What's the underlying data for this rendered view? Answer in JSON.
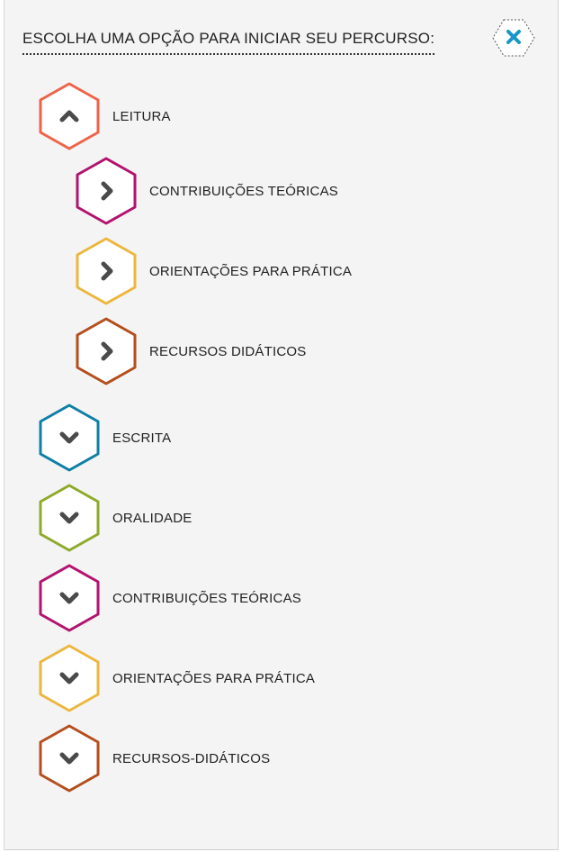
{
  "header": {
    "title": "ESCOLHA UMA OPÇÃO PARA INICIAR SEU PERCURSO:",
    "close_icon": "close-icon",
    "close_color": "#1a95c9"
  },
  "menu": [
    {
      "label": "LEITURA",
      "color": "#ee6349",
      "icon": "chevron-up-icon",
      "level": 0,
      "expanded": true
    },
    {
      "label": "CONTRIBUIÇÕES TEÓRICAS",
      "color": "#b3136f",
      "icon": "chevron-right-icon",
      "level": 1
    },
    {
      "label": "ORIENTAÇÕES PARA PRÁTICA",
      "color": "#ecb73f",
      "icon": "chevron-right-icon",
      "level": 1
    },
    {
      "label": "RECURSOS DIDÁTICOS",
      "color": "#b44e1d",
      "icon": "chevron-right-icon",
      "level": 1
    },
    {
      "label": "ESCRITA",
      "color": "#0f7fa6",
      "icon": "chevron-down-icon",
      "level": 0
    },
    {
      "label": "ORALIDADE",
      "color": "#8eaa2a",
      "icon": "chevron-down-icon",
      "level": 0
    },
    {
      "label": "CONTRIBUIÇÕES TEÓRICAS",
      "color": "#b3136f",
      "icon": "chevron-down-icon",
      "level": 0
    },
    {
      "label": "ORIENTAÇÕES PARA PRÁTICA",
      "color": "#ecb73f",
      "icon": "chevron-down-icon",
      "level": 0
    },
    {
      "label": "RECURSOS-DIDÁTICOS",
      "color": "#b44e1d",
      "icon": "chevron-down-icon",
      "level": 0
    }
  ]
}
